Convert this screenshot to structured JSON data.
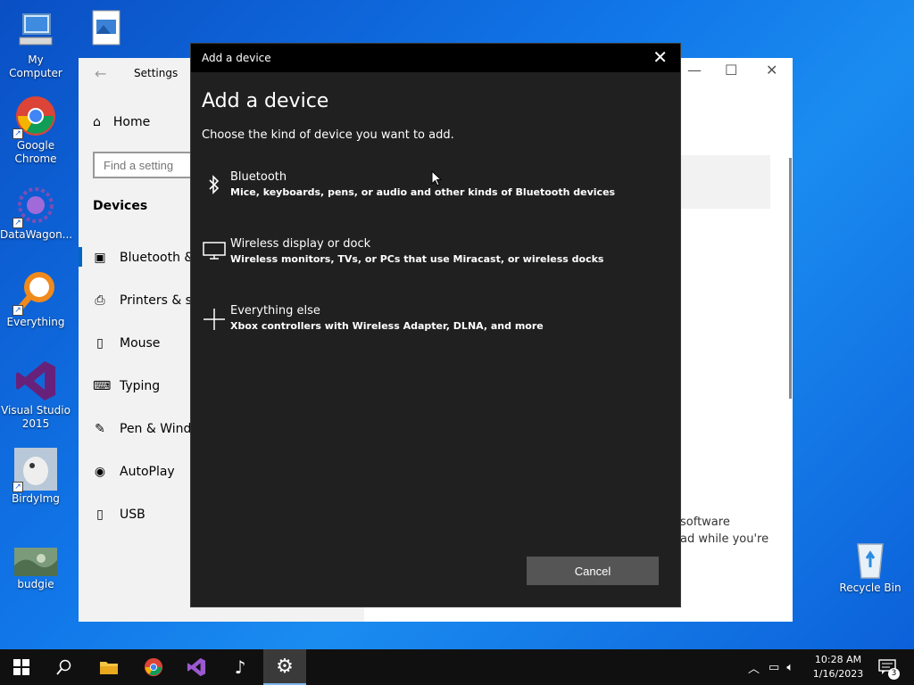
{
  "desktop": {
    "icons": [
      {
        "label": "My Computer"
      },
      {
        "label": "Google Chrome"
      },
      {
        "label": "DataWagon..."
      },
      {
        "label": "Everything"
      },
      {
        "label": "Visual Studio 2015"
      },
      {
        "label": "BirdyImg"
      },
      {
        "label": "budgie"
      },
      {
        "label": "Recycle Bin"
      }
    ]
  },
  "settings": {
    "title": "Settings",
    "home": "Home",
    "search_placeholder": "Find a setting",
    "section": "Devices",
    "items": [
      {
        "label": "Bluetooth &"
      },
      {
        "label": "Printers & sc"
      },
      {
        "label": "Mouse"
      },
      {
        "label": "Typing"
      },
      {
        "label": "Pen & Windo"
      },
      {
        "label": "AutoPlay"
      },
      {
        "label": "USB"
      }
    ],
    "right_text_1": "software",
    "right_text_2": "ad while you're"
  },
  "dialog": {
    "window_title": "Add a device",
    "heading": "Add a device",
    "subtitle": "Choose the kind of device you want to add.",
    "options": [
      {
        "title": "Bluetooth",
        "desc": "Mice, keyboards, pens, or audio and other kinds of Bluetooth devices",
        "icon": "bluetooth-icon"
      },
      {
        "title": "Wireless display or dock",
        "desc": "Wireless monitors, TVs, or PCs that use Miracast, or wireless docks",
        "icon": "monitor-icon"
      },
      {
        "title": "Everything else",
        "desc": "Xbox controllers with Wireless Adapter, DLNA, and more",
        "icon": "plus-icon"
      }
    ],
    "cancel_label": "Cancel"
  },
  "taskbar": {
    "time": "10:28 AM",
    "date": "1/16/2023",
    "notification_count": "3"
  },
  "colors": {
    "dialog_bg": "#202020",
    "accent": "#0067c0",
    "taskbar_bg": "#101010"
  }
}
